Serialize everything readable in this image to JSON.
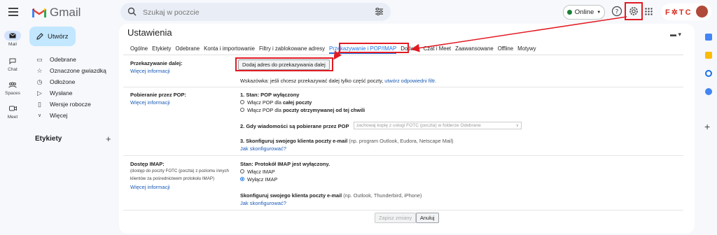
{
  "app": {
    "name": "Gmail",
    "brand": "F✲TC"
  },
  "search": {
    "placeholder": "Szukaj w poczcie"
  },
  "status": {
    "label": "Online",
    "color": "#188038"
  },
  "rail": [
    {
      "label": "Mail",
      "icon": "mail-icon"
    },
    {
      "label": "Chat",
      "icon": "chat-icon"
    },
    {
      "label": "Spaces",
      "icon": "spaces-icon"
    },
    {
      "label": "Meet",
      "icon": "meet-icon"
    }
  ],
  "compose": {
    "label": "Utwórz"
  },
  "nav": [
    {
      "label": "Odebrane",
      "icon": "inbox-icon"
    },
    {
      "label": "Oznaczone gwiazdką",
      "icon": "star-icon"
    },
    {
      "label": "Odłożone",
      "icon": "clock-icon"
    },
    {
      "label": "Wysłane",
      "icon": "send-icon"
    },
    {
      "label": "Wersje robocze",
      "icon": "draft-icon"
    },
    {
      "label": "Więcej",
      "icon": "chevron-down-icon"
    }
  ],
  "labels": {
    "title": "Etykiety",
    "add": "+"
  },
  "settings": {
    "title": "Ustawienia",
    "tabs": [
      "Ogólne",
      "Etykiety",
      "Odebrane",
      "Konta i importowanie",
      "Filtry i zablokowane adresy",
      "Przekazywanie i POP/IMAP",
      "Dodatki",
      "Czat i Meet",
      "Zaawansowane",
      "Offline",
      "Motywy"
    ],
    "forwarding": {
      "label": "Przekazywanie dalej:",
      "more": "Więcej informacji",
      "button": "Dodaj adres do przekazywania dalej",
      "hint_prefix": "Wskazówka: jeśli chcesz przekazywać dalej tylko część poczty,",
      "hint_link": "utwórz odpowiedni filtr."
    },
    "pop": {
      "label": "Pobieranie przez POP:",
      "more": "Więcej informacji",
      "status_title": "1. Stan: POP wyłączony",
      "opt1_prefix": "Włącz POP dla",
      "opt1_bold": "całej poczty",
      "opt2_prefix": "Włącz POP dla",
      "opt2_bold": "poczty otrzymywanej od tej chwili",
      "step2": "2. Gdy wiadomości są pobierane przez POP",
      "step2_select": "zachowaj kopię z usługi FOTC (poczta) w folderze Odebrane",
      "step3_bold": "3. Skonfiguruj swojego klienta poczty e-mail",
      "step3_rest": "(np. program Outlook, Eudora, Netscape Mail)",
      "howto": "Jak skonfigurować?"
    },
    "imap": {
      "label": "Dostęp IMAP:",
      "desc1": "(dostęp do poczty FOTC (poczta) z poziomu innych",
      "desc2": "klientów za pośrednictwem protokołu IMAP)",
      "more": "Więcej informacji",
      "status_title": "Stan: Protokół IMAP jest wyłączony.",
      "opt_on": "Włącz IMAP",
      "opt_off": "Wyłącz IMAP",
      "config_bold": "Skonfiguruj swojego klienta poczty e-mail",
      "config_rest": "(np. Outlook, Thunderbird, iPhone)",
      "howto": "Jak skonfigurować?"
    },
    "save": "Zapisz zmiany",
    "cancel": "Anuluj"
  },
  "colors": {
    "highlight": "#e21b23",
    "link": "#1a5bb7",
    "accent": "#1a73e8"
  }
}
